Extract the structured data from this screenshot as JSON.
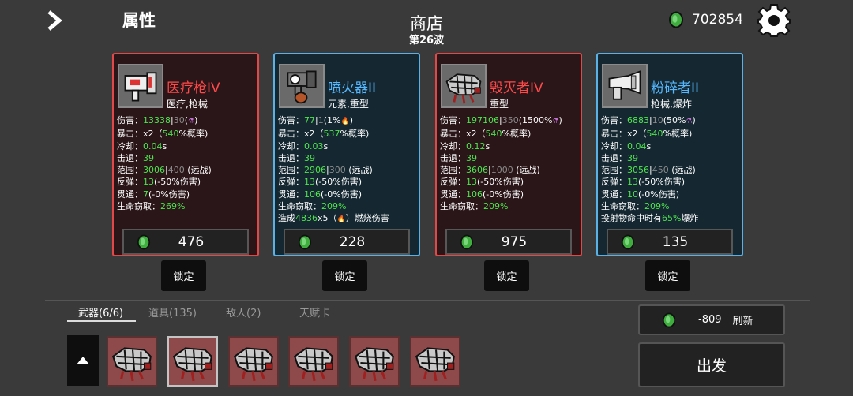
{
  "header": {
    "attributes_label": "属性",
    "shop_title": "商店",
    "wave_label": "第26波",
    "money": "702854"
  },
  "colors": {
    "coin": "#3fae3f",
    "green_text": "#4ee44e",
    "red_card": "#e24848",
    "blue_card": "#5ab1e6"
  },
  "cards": [
    {
      "rarity": "red",
      "icon": "medical-gun-icon",
      "name": "医疗枪IV",
      "tags": "医疗,枪械",
      "stats": [
        {
          "label": "伤害：",
          "parts": [
            {
              "t": "13338",
              "c": "g"
            },
            {
              "t": "|",
              "c": ""
            },
            {
              "t": "30",
              "c": "d"
            },
            {
              "t": "(",
              "c": ""
            },
            {
              "t": "⚗",
              "c": "icon"
            },
            {
              "t": ")",
              "c": ""
            }
          ]
        },
        {
          "label": "暴击：",
          "parts": [
            {
              "t": "x2（",
              "c": ""
            },
            {
              "t": "540",
              "c": "g"
            },
            {
              "t": "%概率)",
              "c": ""
            }
          ]
        },
        {
          "label": "冷却：",
          "parts": [
            {
              "t": "0.04",
              "c": "g"
            },
            {
              "t": "s",
              "c": ""
            }
          ]
        },
        {
          "label": "击退：",
          "parts": [
            {
              "t": "39",
              "c": "g"
            }
          ]
        },
        {
          "label": "范围：",
          "parts": [
            {
              "t": "3006",
              "c": "g"
            },
            {
              "t": "|",
              "c": ""
            },
            {
              "t": "400",
              "c": "d"
            },
            {
              "t": " (远战)",
              "c": ""
            }
          ]
        },
        {
          "label": "反弹：",
          "parts": [
            {
              "t": "13",
              "c": "g"
            },
            {
              "t": "(-50%伤害)",
              "c": ""
            }
          ]
        },
        {
          "label": "贯通：",
          "parts": [
            {
              "t": "7",
              "c": "g"
            },
            {
              "t": "(-0%伤害)",
              "c": ""
            }
          ]
        },
        {
          "label": "生命窃取：",
          "parts": [
            {
              "t": "269%",
              "c": "g"
            }
          ]
        }
      ],
      "price": "476",
      "lock_label": "锁定"
    },
    {
      "rarity": "blue",
      "icon": "flamethrower-icon",
      "name": "喷火器II",
      "tags": "元素,重型",
      "stats": [
        {
          "label": "伤害：",
          "parts": [
            {
              "t": "77",
              "c": "g"
            },
            {
              "t": "|",
              "c": ""
            },
            {
              "t": "1",
              "c": "d"
            },
            {
              "t": "(1%",
              "c": ""
            },
            {
              "t": "🔥",
              "c": "icon"
            },
            {
              "t": ")",
              "c": ""
            }
          ]
        },
        {
          "label": "暴击：",
          "parts": [
            {
              "t": "x2（",
              "c": ""
            },
            {
              "t": "537",
              "c": "g"
            },
            {
              "t": "%概率)",
              "c": ""
            }
          ]
        },
        {
          "label": "冷却：",
          "parts": [
            {
              "t": "0.03",
              "c": "g"
            },
            {
              "t": "s",
              "c": ""
            }
          ]
        },
        {
          "label": "击退：",
          "parts": [
            {
              "t": "39",
              "c": "g"
            }
          ]
        },
        {
          "label": "范围：",
          "parts": [
            {
              "t": "2906",
              "c": "g"
            },
            {
              "t": "|",
              "c": ""
            },
            {
              "t": "300",
              "c": "d"
            },
            {
              "t": " (远战)",
              "c": ""
            }
          ]
        },
        {
          "label": "反弹：",
          "parts": [
            {
              "t": "13",
              "c": "g"
            },
            {
              "t": "(-50%伤害)",
              "c": ""
            }
          ]
        },
        {
          "label": "贯通：",
          "parts": [
            {
              "t": "106",
              "c": "g"
            },
            {
              "t": "(-0%伤害)",
              "c": ""
            }
          ]
        },
        {
          "label": "生命窃取：",
          "parts": [
            {
              "t": "209%",
              "c": "g"
            }
          ]
        },
        {
          "label": "造成",
          "parts": [
            {
              "t": "4836",
              "c": "g"
            },
            {
              "t": "x5（",
              "c": ""
            },
            {
              "t": "🔥",
              "c": "icon"
            },
            {
              "t": "）燃烧伤害",
              "c": ""
            }
          ]
        }
      ],
      "price": "228",
      "lock_label": "锁定"
    },
    {
      "rarity": "red",
      "icon": "destroyer-icon",
      "name": "毁灭者IV",
      "tags": "重型",
      "stats": [
        {
          "label": "伤害：",
          "parts": [
            {
              "t": "197106",
              "c": "g"
            },
            {
              "t": "|",
              "c": ""
            },
            {
              "t": "350",
              "c": "d"
            },
            {
              "t": "(1500%",
              "c": ""
            },
            {
              "t": "⚗",
              "c": "icon"
            },
            {
              "t": ")",
              "c": ""
            }
          ]
        },
        {
          "label": "暴击：",
          "parts": [
            {
              "t": "x2（",
              "c": ""
            },
            {
              "t": "540",
              "c": "g"
            },
            {
              "t": "%概率)",
              "c": ""
            }
          ]
        },
        {
          "label": "冷却：",
          "parts": [
            {
              "t": "0.12",
              "c": "g"
            },
            {
              "t": "s",
              "c": ""
            }
          ]
        },
        {
          "label": "击退：",
          "parts": [
            {
              "t": "39",
              "c": "g"
            }
          ]
        },
        {
          "label": "范围：",
          "parts": [
            {
              "t": "3606",
              "c": "g"
            },
            {
              "t": "|",
              "c": ""
            },
            {
              "t": "1000",
              "c": "d"
            },
            {
              "t": " (远战)",
              "c": ""
            }
          ]
        },
        {
          "label": "反弹：",
          "parts": [
            {
              "t": "13",
              "c": "g"
            },
            {
              "t": "(-50%伤害)",
              "c": ""
            }
          ]
        },
        {
          "label": "贯通：",
          "parts": [
            {
              "t": "106",
              "c": "g"
            },
            {
              "t": "(-0%伤害)",
              "c": ""
            }
          ]
        },
        {
          "label": "生命窃取：",
          "parts": [
            {
              "t": "209%",
              "c": "g"
            }
          ]
        }
      ],
      "price": "975",
      "lock_label": "锁定"
    },
    {
      "rarity": "blue",
      "icon": "crusher-icon",
      "name": "粉碎者II",
      "tags": "枪械,爆炸",
      "stats": [
        {
          "label": "伤害：",
          "parts": [
            {
              "t": "6883",
              "c": "g"
            },
            {
              "t": "|",
              "c": ""
            },
            {
              "t": "10",
              "c": "d"
            },
            {
              "t": "(50%",
              "c": ""
            },
            {
              "t": "⚗",
              "c": "icon"
            },
            {
              "t": ")",
              "c": ""
            }
          ]
        },
        {
          "label": "暴击：",
          "parts": [
            {
              "t": "x2（",
              "c": ""
            },
            {
              "t": "540",
              "c": "g"
            },
            {
              "t": "%概率)",
              "c": ""
            }
          ]
        },
        {
          "label": "冷却：",
          "parts": [
            {
              "t": "0.04",
              "c": "g"
            },
            {
              "t": "s",
              "c": ""
            }
          ]
        },
        {
          "label": "击退：",
          "parts": [
            {
              "t": "39",
              "c": "g"
            }
          ]
        },
        {
          "label": "范围：",
          "parts": [
            {
              "t": "3056",
              "c": "g"
            },
            {
              "t": "|",
              "c": ""
            },
            {
              "t": "450",
              "c": "d"
            },
            {
              "t": " (远战)",
              "c": ""
            }
          ]
        },
        {
          "label": "反弹：",
          "parts": [
            {
              "t": "13",
              "c": "g"
            },
            {
              "t": "(-50%伤害)",
              "c": ""
            }
          ]
        },
        {
          "label": "贯通：",
          "parts": [
            {
              "t": "10",
              "c": "g"
            },
            {
              "t": "(-0%伤害)",
              "c": ""
            }
          ]
        },
        {
          "label": "生命窃取：",
          "parts": [
            {
              "t": "209%",
              "c": "g"
            }
          ]
        },
        {
          "label": "投射物命中时有",
          "parts": [
            {
              "t": "65%",
              "c": "g"
            },
            {
              "t": "爆炸",
              "c": ""
            }
          ]
        }
      ],
      "price": "135",
      "lock_label": "锁定"
    }
  ],
  "tabs": [
    {
      "label": "武器(6/6)",
      "active": true
    },
    {
      "label": "道具(135)",
      "active": false
    },
    {
      "label": "敌人(2)",
      "active": false
    },
    {
      "label": "天赋卡",
      "active": false
    }
  ],
  "inventory": [
    {
      "icon": "destroyer-icon",
      "selected": false
    },
    {
      "icon": "destroyer-icon",
      "selected": true
    },
    {
      "icon": "destroyer-icon",
      "selected": false
    },
    {
      "icon": "destroyer-icon",
      "selected": false
    },
    {
      "icon": "destroyer-icon",
      "selected": false
    },
    {
      "icon": "destroyer-icon",
      "selected": false
    }
  ],
  "refresh": {
    "cost": "-809",
    "label": "刷新"
  },
  "go_label": "出发"
}
